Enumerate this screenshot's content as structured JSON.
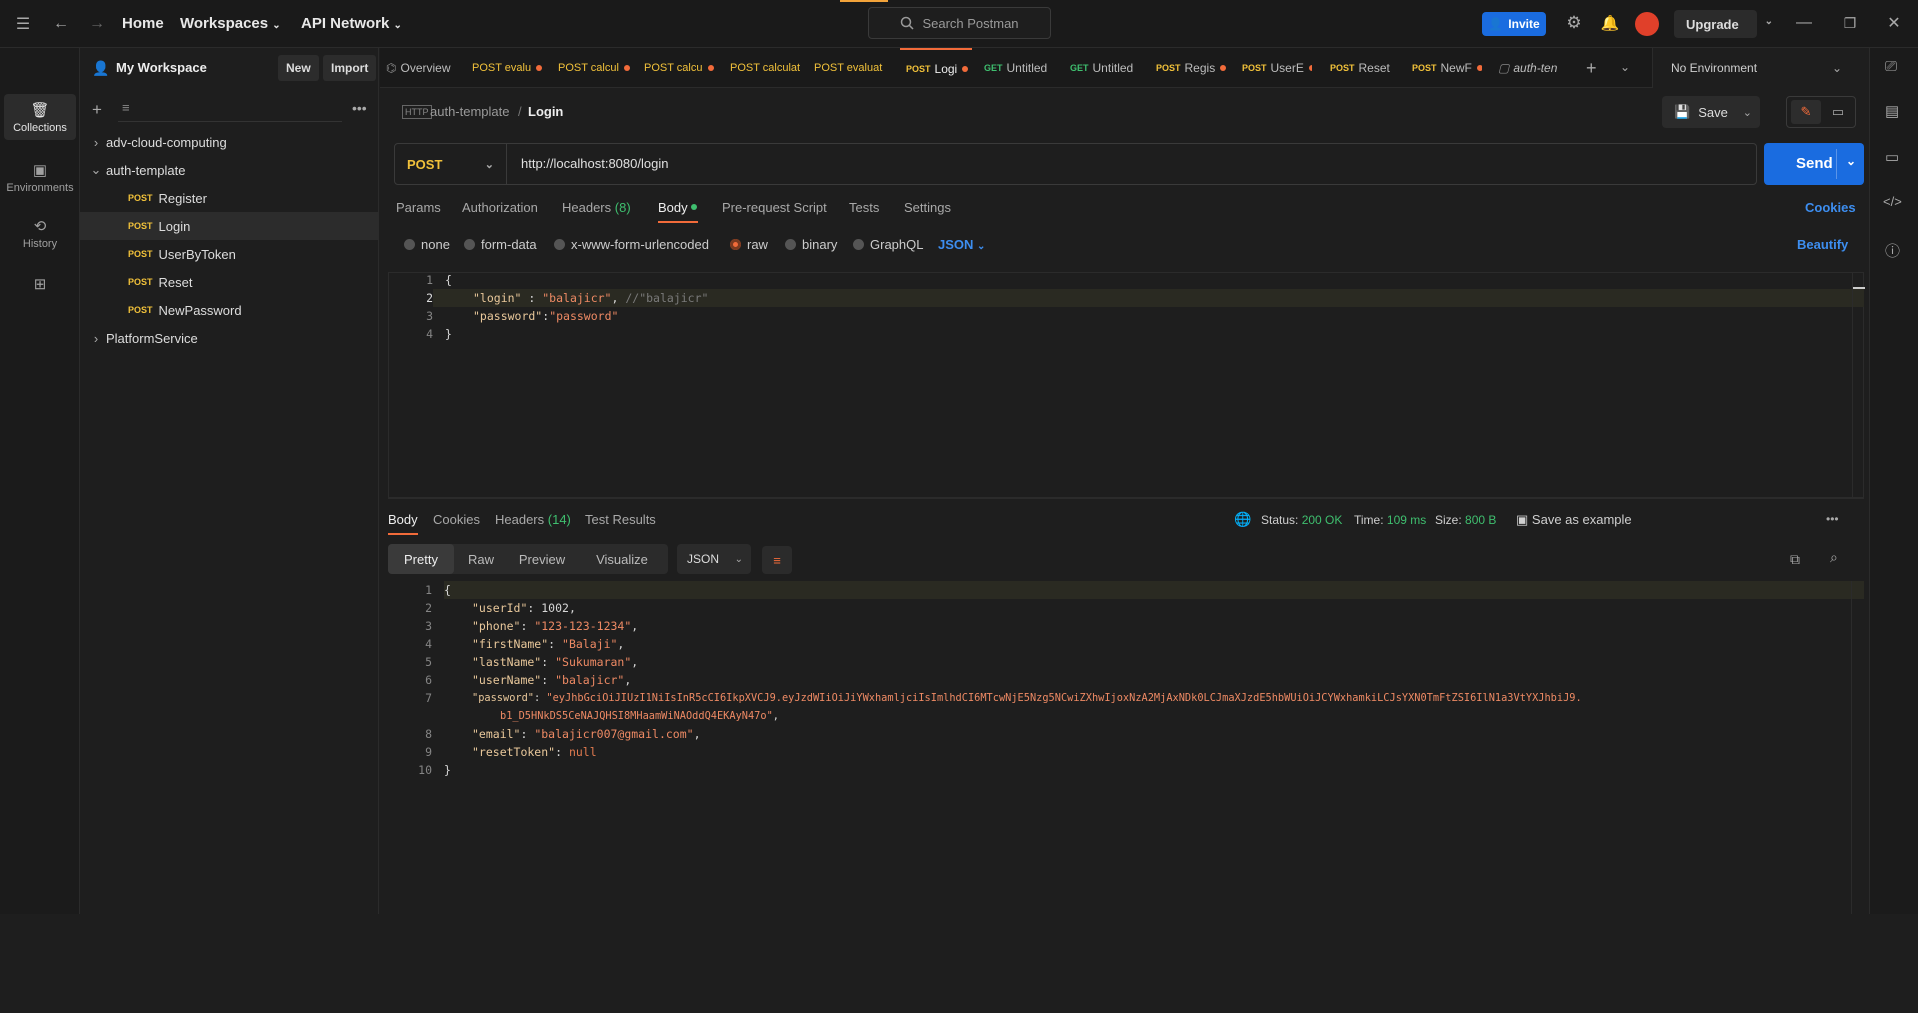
{
  "topbar": {
    "home": "Home",
    "workspaces": "Workspaces",
    "api_network": "API Network",
    "search_placeholder": "Search Postman",
    "invite": "Invite",
    "upgrade": "Upgrade"
  },
  "rail": [
    {
      "label": "Collections"
    },
    {
      "label": "Environments"
    },
    {
      "label": "History"
    }
  ],
  "sidebar": {
    "workspace": "My Workspace",
    "new": "New",
    "import": "Import",
    "tree": [
      {
        "label": "adv-cloud-computing"
      },
      {
        "label": "auth-template"
      },
      {
        "method": "POST",
        "label": "Register"
      },
      {
        "method": "POST",
        "label": "Login"
      },
      {
        "method": "POST",
        "label": "UserByToken"
      },
      {
        "method": "POST",
        "label": "Reset"
      },
      {
        "method": "POST",
        "label": "NewPassword"
      },
      {
        "label": "PlatformService"
      }
    ]
  },
  "tabs": [
    {
      "method": "",
      "label": "Overview"
    },
    {
      "method": "POST",
      "label": "POST evalu"
    },
    {
      "method": "POST",
      "label": "POST calcul"
    },
    {
      "method": "POST",
      "label": "POST calcu"
    },
    {
      "method": "POST",
      "label": "POST calculat"
    },
    {
      "method": "POST",
      "label": "POST evaluat"
    },
    {
      "method": "POST",
      "label": "Logi"
    },
    {
      "method": "GET",
      "label": "Untitled"
    },
    {
      "method": "GET",
      "label": "Untitled"
    },
    {
      "method": "POST",
      "label": "Regis"
    },
    {
      "method": "POST",
      "label": "UserE"
    },
    {
      "method": "POST",
      "label": "Reset"
    },
    {
      "method": "POST",
      "label": "NewF"
    },
    {
      "method": "",
      "label": "auth-ten"
    }
  ],
  "environment": "No Environment",
  "request": {
    "collection": "auth-template",
    "name": "Login",
    "save": "Save",
    "method": "POST",
    "url": "http://localhost:8080/login",
    "send": "Send"
  },
  "req_tabs": {
    "params": "Params",
    "authorization": "Authorization",
    "headers": "Headers",
    "headers_count": "(8)",
    "body": "Body",
    "prerequest": "Pre-request Script",
    "tests": "Tests",
    "settings": "Settings",
    "cookies": "Cookies"
  },
  "body_types": {
    "none": "none",
    "form_data": "form-data",
    "urlencoded": "x-www-form-urlencoded",
    "raw": "raw",
    "binary": "binary",
    "graphql": "GraphQL",
    "json": "JSON",
    "beautify": "Beautify"
  },
  "req_body": {
    "line_numbers": [
      "1",
      "2",
      "3",
      "4"
    ],
    "open": "{",
    "close": "}",
    "login_key": "\"login\"",
    "login_val": "\"balajicr\"",
    "login_comment": "//\"balajicr\"",
    "password_key": "\"password\"",
    "password_val": "\"password\""
  },
  "resp_tabs": {
    "body": "Body",
    "cookies": "Cookies",
    "headers": "Headers",
    "headers_count": "(14)",
    "tests": "Test Results"
  },
  "resp_status": {
    "status_label": "Status:",
    "status": "200 OK",
    "time_label": "Time:",
    "time": "109 ms",
    "size_label": "Size:",
    "size": "800 B",
    "save_example": "Save as example"
  },
  "resp_views": {
    "pretty": "Pretty",
    "raw": "Raw",
    "preview": "Preview",
    "visualize": "Visualize",
    "format": "JSON"
  },
  "resp_body": {
    "line_numbers": [
      "1",
      "2",
      "3",
      "4",
      "5",
      "6",
      "7",
      "",
      "8",
      "9",
      "10"
    ],
    "open": "{",
    "close": "}",
    "userId_k": "\"userId\"",
    "userId_v": "1002",
    "phone_k": "\"phone\"",
    "phone_v": "\"123-123-1234\"",
    "firstName_k": "\"firstName\"",
    "firstName_v": "\"Balaji\"",
    "lastName_k": "\"lastName\"",
    "lastName_v": "\"Sukumaran\"",
    "userName_k": "\"userName\"",
    "userName_v": "\"balajicr\"",
    "password_k": "\"password\"",
    "password_v1": "\"eyJhbGciOiJIUzI1NiIsInR5cCI6IkpXVCJ9.eyJzdWIiOiJiYWxhamljciIsImlhdCI6MTcwNjE5Nzg5NCwiZXhwIjoxNzA2MjAxNDk0LCJmaXJzdE5hbWUiOiJCYWxhamkiLCJsYXN0TmFtZSI6IlN1a3VtYXJhbiJ9.",
    "password_v2": "b1_D5HNkDS5CeNAJQHSI8MHaamWiNAOddQ4EKAyN47o\"",
    "email_k": "\"email\"",
    "email_v": "\"balajicr007@gmail.com\"",
    "reset_k": "\"resetToken\"",
    "reset_v": "null"
  }
}
